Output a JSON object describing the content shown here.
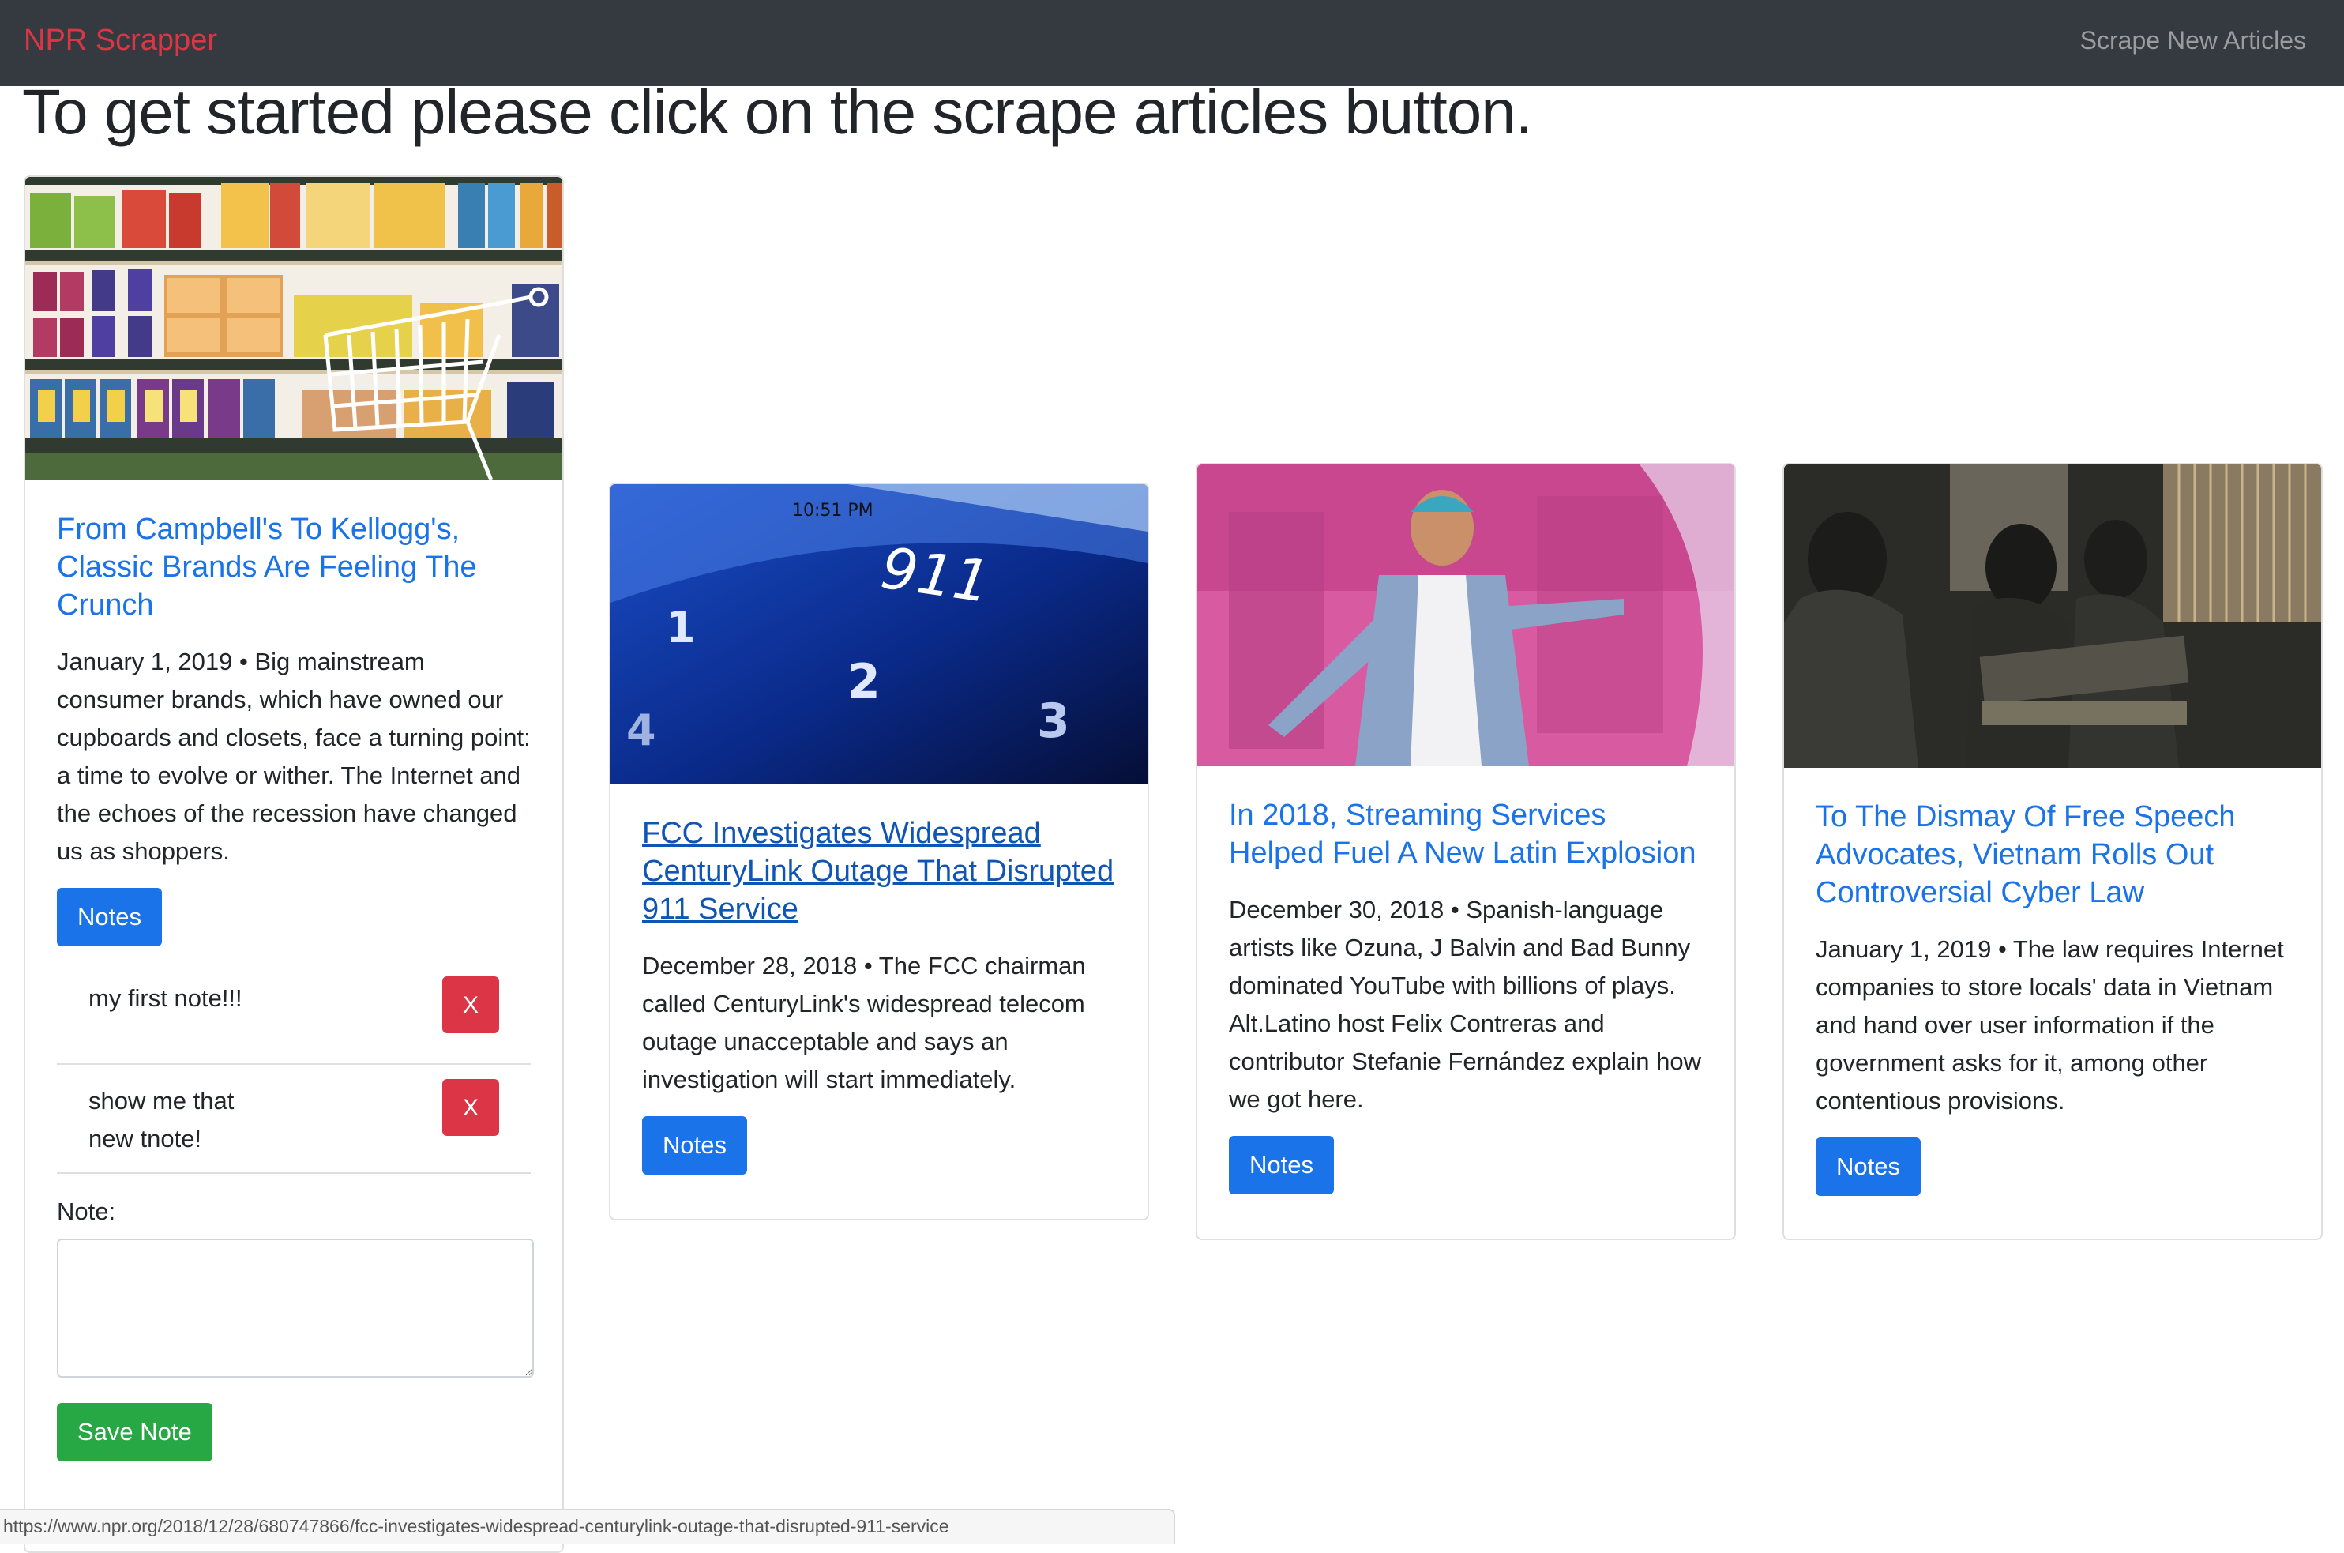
{
  "navbar": {
    "brand": "NPR Scrapper",
    "scrape_link": "Scrape New Articles"
  },
  "headline": "To get started please click on the scrape articles button.",
  "articles": [
    {
      "title": "From Campbell's To Kellogg's, Classic Brands Are Feeling The Crunch",
      "summary": "January 1, 2019 • Big mainstream consumer brands, which have owned our cupboards and closets, face a turning point: a time to evolve or wither. The Internet and the echoes of the recession have changed us as shoppers.",
      "notes_label": "Notes",
      "image_icon": "grocery-shelf-illustration"
    },
    {
      "title": "FCC Investigates Widespread CenturyLink Outage That Disrupted 911 Service",
      "summary": "December 28, 2018 • The FCC chairman called CenturyLink's widespread telecom outage unacceptable and says an investigation will start immediately.",
      "notes_label": "Notes",
      "image_icon": "phone-911-photo"
    },
    {
      "title": "In 2018, Streaming Services Helped Fuel A New Latin Explosion",
      "summary": "December 30, 2018 • Spanish-language artists like Ozuna, J Balvin and Bad Bunny dominated YouTube with billions of plays. Alt.Latino host Felix Contreras and contributor Stefanie Fernández explain how we got here.",
      "notes_label": "Notes",
      "image_icon": "performer-stage-photo"
    },
    {
      "title": "To The Dismay Of Free Speech Advocates, Vietnam Rolls Out Controversial Cyber Law",
      "summary": "January 1, 2019 • The law requires Internet companies to store locals' data in Vietnam and hand over user information if the government asks for it, among other contentious provisions.",
      "notes_label": "Notes",
      "image_icon": "internet-cafe-photo"
    }
  ],
  "notes_panel": {
    "notes": [
      {
        "text": "my first note!!!",
        "delete_label": "X"
      },
      {
        "text": "show me that new tnote!",
        "delete_label": "X"
      }
    ],
    "note_label": "Note:",
    "note_value": "",
    "save_label": "Save Note"
  },
  "status_url": "https://www.npr.org/2018/12/28/680747866/fcc-investigates-widespread-centurylink-outage-that-disrupted-911-service",
  "colors": {
    "navbar": "#343a40",
    "brand": "#dc3545",
    "primary": "#1a73e8",
    "danger": "#dc3545",
    "success": "#28a745"
  }
}
